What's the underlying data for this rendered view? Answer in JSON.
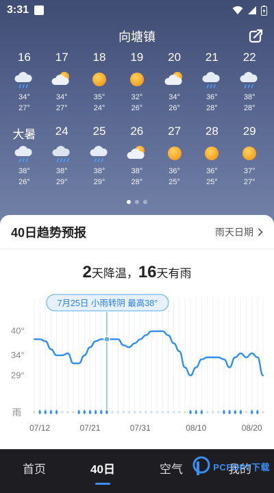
{
  "status": {
    "time": "3:31"
  },
  "header": {
    "title": "向塘镇"
  },
  "week1": [
    {
      "day": "16",
      "icon": "cloud-rain-icon",
      "hi": "34°",
      "lo": "27°"
    },
    {
      "day": "17",
      "icon": "sun-cloud-icon",
      "hi": "34°",
      "lo": "27°"
    },
    {
      "day": "18",
      "icon": "sun-icon",
      "hi": "35°",
      "lo": "24°"
    },
    {
      "day": "19",
      "icon": "sun-icon",
      "hi": "32°",
      "lo": "26°"
    },
    {
      "day": "20",
      "icon": "sun-cloud-icon",
      "hi": "34°",
      "lo": "26°"
    },
    {
      "day": "21",
      "icon": "cloud-rain-icon",
      "hi": "36°",
      "lo": "28°"
    },
    {
      "day": "22",
      "icon": "cloud-rain-icon",
      "hi": "38°",
      "lo": "28°"
    }
  ],
  "week2": [
    {
      "day": "大暑",
      "icon": "cloud-rain-icon",
      "hi": "38°",
      "lo": "26°"
    },
    {
      "day": "24",
      "icon": "cloud-heavy-rain-icon",
      "hi": "38°",
      "lo": "29°"
    },
    {
      "day": "25",
      "icon": "cloud-rain-icon",
      "hi": "38°",
      "lo": "29°"
    },
    {
      "day": "26",
      "icon": "sun-cloud-icon",
      "hi": "38°",
      "lo": "28°"
    },
    {
      "day": "27",
      "icon": "sun-icon",
      "hi": "36°",
      "lo": "25°"
    },
    {
      "day": "28",
      "icon": "sun-icon",
      "hi": "36°",
      "lo": "25°"
    },
    {
      "day": "29",
      "icon": "sun-icon",
      "hi": "37°",
      "lo": "27°"
    }
  ],
  "card": {
    "title": "40日趋势预报",
    "link": "雨天日期",
    "summary_num1": "2",
    "summary_txt1": "天降温，",
    "summary_num2": "16",
    "summary_txt2": "天有雨"
  },
  "chart_data": {
    "type": "line",
    "title": "",
    "tooltip": "7月25日 小雨转阴 最高38°",
    "highlight_index": 13,
    "y_ticks": [
      "40°",
      "34°",
      "29°"
    ],
    "ylim": [
      26,
      43
    ],
    "rain_label": "雨",
    "x_tick_labels": [
      {
        "index": 1,
        "label": "07/12"
      },
      {
        "index": 10,
        "label": "07/21"
      },
      {
        "index": 19,
        "label": "07/31"
      },
      {
        "index": 29,
        "label": "08/10"
      },
      {
        "index": 39,
        "label": "08/20"
      }
    ],
    "values": [
      38,
      38,
      37.5,
      35.5,
      34,
      34,
      34.5,
      32,
      32,
      34,
      36,
      37.5,
      38,
      38,
      38,
      38,
      36.5,
      36,
      37,
      38,
      39,
      40,
      40,
      40,
      39,
      37,
      35,
      31,
      29,
      31,
      33,
      33.5,
      33.5,
      33.5,
      33,
      31,
      33.5,
      34.5,
      33.5,
      34.5,
      33.5,
      29
    ],
    "rain_days": [
      1,
      2,
      3,
      4,
      8,
      9,
      10,
      11,
      12,
      13,
      28,
      29,
      30,
      34,
      35,
      36,
      37,
      39,
      40
    ]
  },
  "tabs": [
    {
      "label": "首页"
    },
    {
      "label": "40日"
    },
    {
      "label": "空气"
    },
    {
      "label": "我的"
    }
  ],
  "watermark": {
    "text": "PCFOPT下载"
  }
}
